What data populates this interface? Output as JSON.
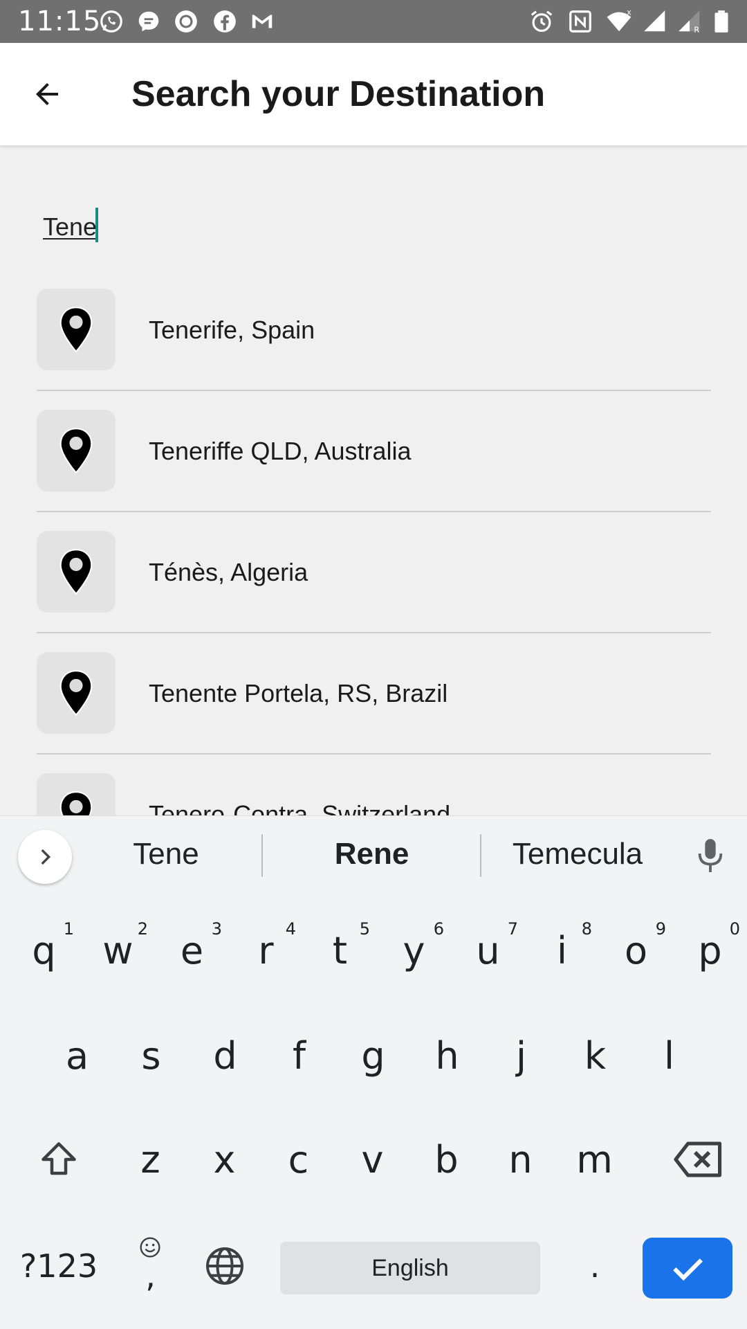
{
  "status_bar": {
    "time": "11:15",
    "left_icons": [
      "whatsapp-icon",
      "messenger-icon",
      "circle-app-icon",
      "facebook-icon",
      "gmail-icon"
    ],
    "right_icons": [
      "alarm-icon",
      "nfc-icon",
      "wifi-icon",
      "signal-icon",
      "signal-roaming-icon",
      "battery-icon"
    ]
  },
  "app_bar": {
    "title": "Search your Destination",
    "back_icon": "arrow-back-icon"
  },
  "search": {
    "value": "Tene"
  },
  "results": [
    {
      "label": "Tenerife, Spain"
    },
    {
      "label": "Teneriffe QLD, Australia"
    },
    {
      "label": "Ténès, Algeria"
    },
    {
      "label": "Tenente Portela, RS, Brazil"
    },
    {
      "label": "Tenero-Contra, Switzerland"
    }
  ],
  "suggestions": {
    "items": [
      "Tene",
      "Rene",
      "Temecula"
    ],
    "bold_index": 1
  },
  "keyboard": {
    "row1": [
      {
        "k": "q",
        "h": "1"
      },
      {
        "k": "w",
        "h": "2"
      },
      {
        "k": "e",
        "h": "3"
      },
      {
        "k": "r",
        "h": "4"
      },
      {
        "k": "t",
        "h": "5"
      },
      {
        "k": "y",
        "h": "6"
      },
      {
        "k": "u",
        "h": "7"
      },
      {
        "k": "i",
        "h": "8"
      },
      {
        "k": "o",
        "h": "9"
      },
      {
        "k": "p",
        "h": "0"
      }
    ],
    "row2": [
      "a",
      "s",
      "d",
      "f",
      "g",
      "h",
      "j",
      "k",
      "l"
    ],
    "row3": [
      "z",
      "x",
      "c",
      "v",
      "b",
      "n",
      "m"
    ],
    "symbols_label": "?123",
    "comma": ",",
    "space_label": "English",
    "period": "."
  },
  "colors": {
    "accent": "#1b8a83",
    "enter_key": "#1a73e8"
  }
}
